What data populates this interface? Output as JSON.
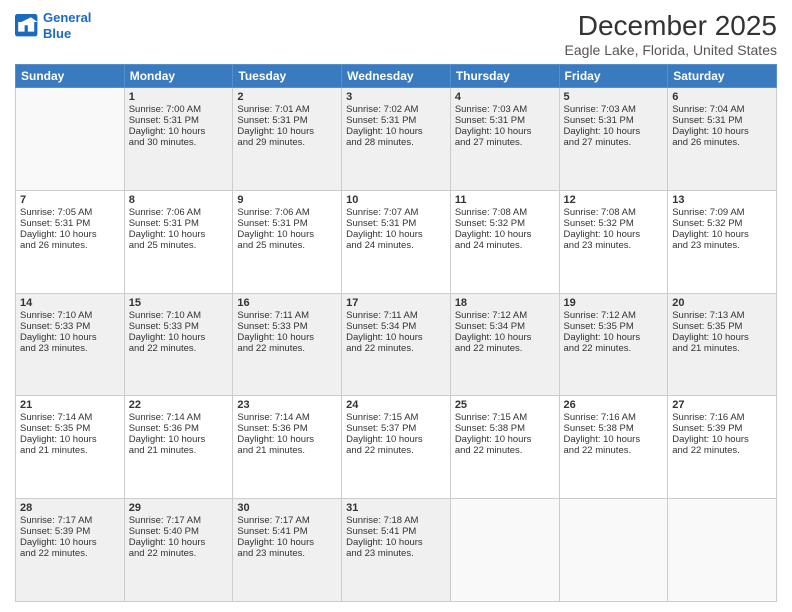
{
  "logo": {
    "line1": "General",
    "line2": "Blue"
  },
  "title": "December 2025",
  "subtitle": "Eagle Lake, Florida, United States",
  "headers": [
    "Sunday",
    "Monday",
    "Tuesday",
    "Wednesday",
    "Thursday",
    "Friday",
    "Saturday"
  ],
  "weeks": [
    [
      {
        "day": "",
        "info": ""
      },
      {
        "day": "1",
        "info": "Sunrise: 7:00 AM\nSunset: 5:31 PM\nDaylight: 10 hours\nand 30 minutes."
      },
      {
        "day": "2",
        "info": "Sunrise: 7:01 AM\nSunset: 5:31 PM\nDaylight: 10 hours\nand 29 minutes."
      },
      {
        "day": "3",
        "info": "Sunrise: 7:02 AM\nSunset: 5:31 PM\nDaylight: 10 hours\nand 28 minutes."
      },
      {
        "day": "4",
        "info": "Sunrise: 7:03 AM\nSunset: 5:31 PM\nDaylight: 10 hours\nand 27 minutes."
      },
      {
        "day": "5",
        "info": "Sunrise: 7:03 AM\nSunset: 5:31 PM\nDaylight: 10 hours\nand 27 minutes."
      },
      {
        "day": "6",
        "info": "Sunrise: 7:04 AM\nSunset: 5:31 PM\nDaylight: 10 hours\nand 26 minutes."
      }
    ],
    [
      {
        "day": "7",
        "info": "Sunrise: 7:05 AM\nSunset: 5:31 PM\nDaylight: 10 hours\nand 26 minutes."
      },
      {
        "day": "8",
        "info": "Sunrise: 7:06 AM\nSunset: 5:31 PM\nDaylight: 10 hours\nand 25 minutes."
      },
      {
        "day": "9",
        "info": "Sunrise: 7:06 AM\nSunset: 5:31 PM\nDaylight: 10 hours\nand 25 minutes."
      },
      {
        "day": "10",
        "info": "Sunrise: 7:07 AM\nSunset: 5:31 PM\nDaylight: 10 hours\nand 24 minutes."
      },
      {
        "day": "11",
        "info": "Sunrise: 7:08 AM\nSunset: 5:32 PM\nDaylight: 10 hours\nand 24 minutes."
      },
      {
        "day": "12",
        "info": "Sunrise: 7:08 AM\nSunset: 5:32 PM\nDaylight: 10 hours\nand 23 minutes."
      },
      {
        "day": "13",
        "info": "Sunrise: 7:09 AM\nSunset: 5:32 PM\nDaylight: 10 hours\nand 23 minutes."
      }
    ],
    [
      {
        "day": "14",
        "info": "Sunrise: 7:10 AM\nSunset: 5:33 PM\nDaylight: 10 hours\nand 23 minutes."
      },
      {
        "day": "15",
        "info": "Sunrise: 7:10 AM\nSunset: 5:33 PM\nDaylight: 10 hours\nand 22 minutes."
      },
      {
        "day": "16",
        "info": "Sunrise: 7:11 AM\nSunset: 5:33 PM\nDaylight: 10 hours\nand 22 minutes."
      },
      {
        "day": "17",
        "info": "Sunrise: 7:11 AM\nSunset: 5:34 PM\nDaylight: 10 hours\nand 22 minutes."
      },
      {
        "day": "18",
        "info": "Sunrise: 7:12 AM\nSunset: 5:34 PM\nDaylight: 10 hours\nand 22 minutes."
      },
      {
        "day": "19",
        "info": "Sunrise: 7:12 AM\nSunset: 5:35 PM\nDaylight: 10 hours\nand 22 minutes."
      },
      {
        "day": "20",
        "info": "Sunrise: 7:13 AM\nSunset: 5:35 PM\nDaylight: 10 hours\nand 21 minutes."
      }
    ],
    [
      {
        "day": "21",
        "info": "Sunrise: 7:14 AM\nSunset: 5:35 PM\nDaylight: 10 hours\nand 21 minutes."
      },
      {
        "day": "22",
        "info": "Sunrise: 7:14 AM\nSunset: 5:36 PM\nDaylight: 10 hours\nand 21 minutes."
      },
      {
        "day": "23",
        "info": "Sunrise: 7:14 AM\nSunset: 5:36 PM\nDaylight: 10 hours\nand 21 minutes."
      },
      {
        "day": "24",
        "info": "Sunrise: 7:15 AM\nSunset: 5:37 PM\nDaylight: 10 hours\nand 22 minutes."
      },
      {
        "day": "25",
        "info": "Sunrise: 7:15 AM\nSunset: 5:38 PM\nDaylight: 10 hours\nand 22 minutes."
      },
      {
        "day": "26",
        "info": "Sunrise: 7:16 AM\nSunset: 5:38 PM\nDaylight: 10 hours\nand 22 minutes."
      },
      {
        "day": "27",
        "info": "Sunrise: 7:16 AM\nSunset: 5:39 PM\nDaylight: 10 hours\nand 22 minutes."
      }
    ],
    [
      {
        "day": "28",
        "info": "Sunrise: 7:17 AM\nSunset: 5:39 PM\nDaylight: 10 hours\nand 22 minutes."
      },
      {
        "day": "29",
        "info": "Sunrise: 7:17 AM\nSunset: 5:40 PM\nDaylight: 10 hours\nand 22 minutes."
      },
      {
        "day": "30",
        "info": "Sunrise: 7:17 AM\nSunset: 5:41 PM\nDaylight: 10 hours\nand 23 minutes."
      },
      {
        "day": "31",
        "info": "Sunrise: 7:18 AM\nSunset: 5:41 PM\nDaylight: 10 hours\nand 23 minutes."
      },
      {
        "day": "",
        "info": ""
      },
      {
        "day": "",
        "info": ""
      },
      {
        "day": "",
        "info": ""
      }
    ]
  ],
  "row_styles": [
    "shaded",
    "white",
    "shaded",
    "white",
    "shaded"
  ]
}
